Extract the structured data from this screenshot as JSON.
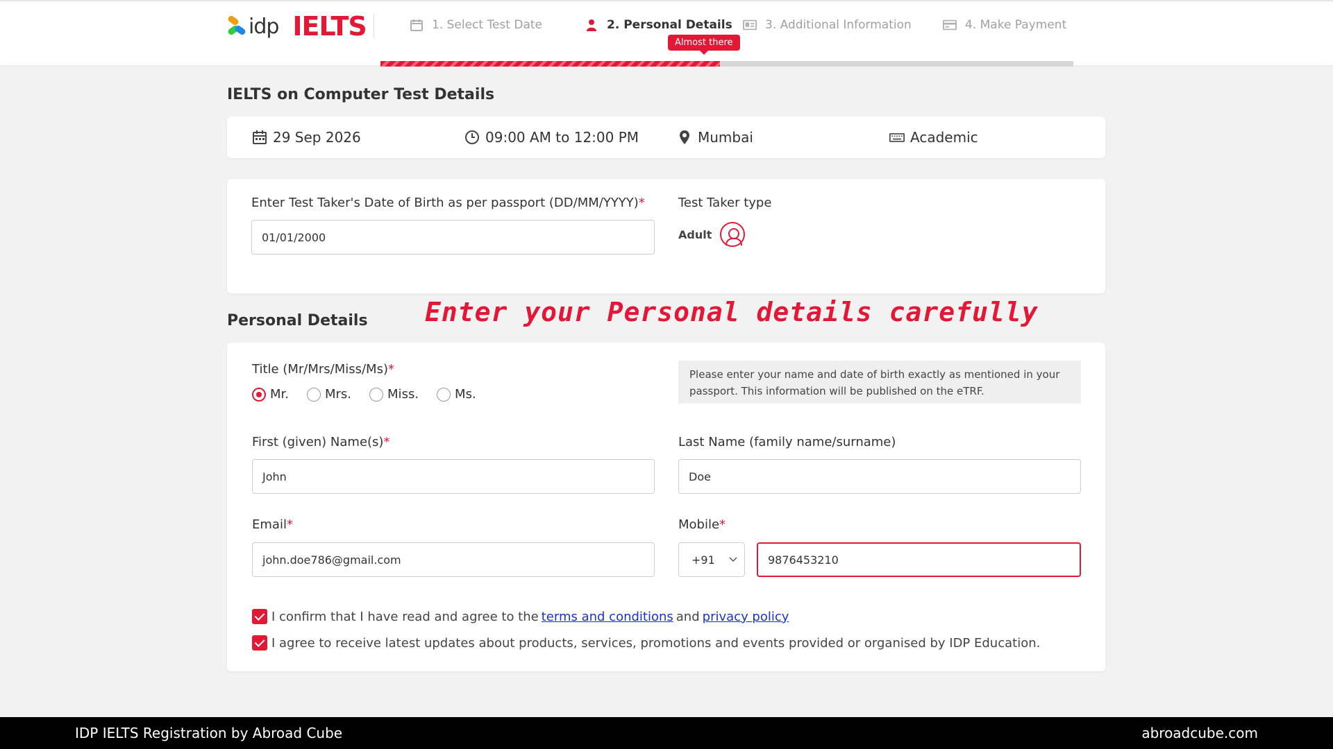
{
  "header": {
    "brand_idp": "idp",
    "brand_ielts": "IELTS",
    "steps": [
      {
        "label": "1. Select Test Date",
        "icon": "calendar-icon"
      },
      {
        "label": "2. Personal Details",
        "icon": "user-icon"
      },
      {
        "label": "3. Additional Information",
        "icon": "id-card-icon"
      },
      {
        "label": "4. Make Payment",
        "icon": "credit-card-icon"
      }
    ],
    "badge": "Almost there",
    "progress": 0.49,
    "accent": "#e31837"
  },
  "test_details": {
    "heading": "IELTS on Computer Test Details",
    "date": "29 Sep 2026",
    "time": "09:00 AM to 12:00 PM",
    "location": "Mumbai",
    "module": "Academic"
  },
  "dob": {
    "label": "Enter Test Taker's Date of Birth as per passport (DD/MM/YYYY)",
    "required_mark": "*",
    "value": "01/01/2000",
    "taker_type_label": "Test Taker type",
    "taker_type": "Adult"
  },
  "annotation": "Enter your Personal details carefully",
  "personal": {
    "heading": "Personal Details",
    "title_label": "Title (Mr/Mrs/Miss/Ms)",
    "titles": [
      "Mr.",
      "Mrs.",
      "Miss.",
      "Ms."
    ],
    "selected_title": "Mr.",
    "info": "Please enter your name and date of birth exactly as mentioned in your passport. This information will be published on the eTRF.",
    "first_name_label": "First (given) Name(s)",
    "first_name": "John",
    "last_name_label": "Last Name (family name/surname)",
    "last_name": "Doe",
    "email_label": "Email",
    "email": "john.doe786@gmail.com",
    "mobile_label": "Mobile",
    "country_code": "+91",
    "mobile": "9876453210",
    "consent1_pre": "I confirm that I have read and agree to the",
    "consent1_link1": "terms and conditions",
    "consent1_and": "and",
    "consent1_link2": "privacy policy",
    "consent2": "I agree to receive latest updates about products, services, promotions and events provided or organised by IDP Education."
  },
  "footer": {
    "left": "IDP IELTS Registration by Abroad Cube",
    "right": "abroadcube.com"
  }
}
